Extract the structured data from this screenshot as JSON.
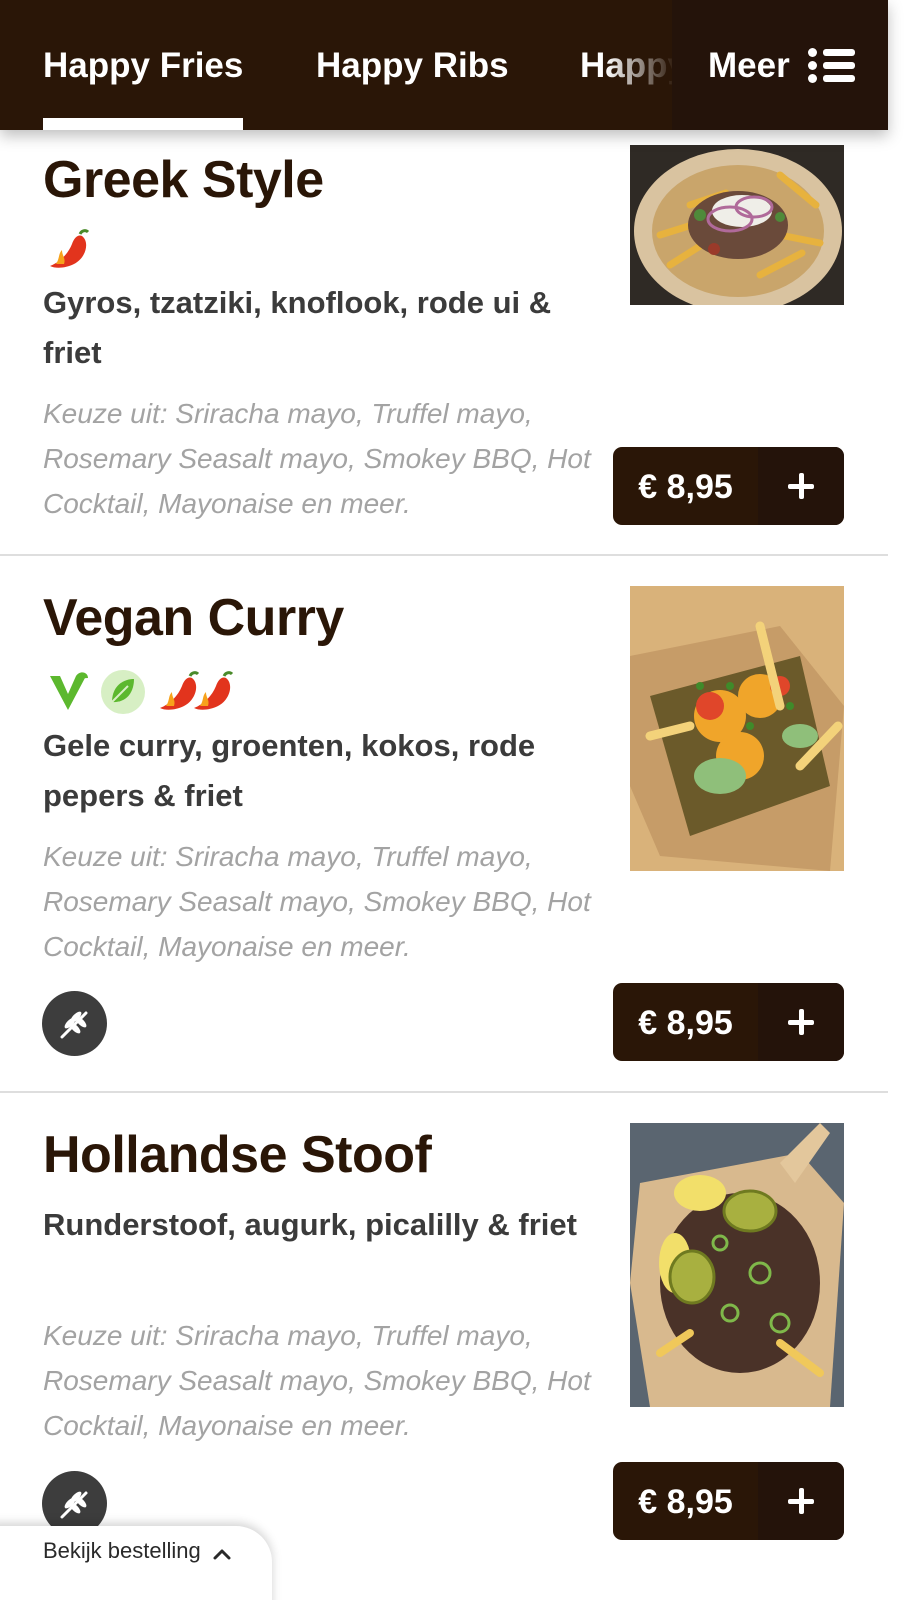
{
  "nav": {
    "tabs": [
      {
        "label": "Happy Fries",
        "active": true
      },
      {
        "label": "Happy Ribs",
        "active": false
      },
      {
        "label": "Happy",
        "active": false
      }
    ],
    "more_label": "Meer",
    "more_icon": "list-icon"
  },
  "products": [
    {
      "title": "Greek Style",
      "badges": [
        "chili-pepper-icon"
      ],
      "description": "Gyros, tzatziki, knoflook, rode ui & friet",
      "choices": "Keuze uit: Sriracha mayo, Truffel mayo, Rosemary Seasalt mayo, Smokey BBQ, Hot Cocktail, Mayonaise en meer.",
      "price": "€ 8,95",
      "add_icon": "plus-icon",
      "allergen_icon": null
    },
    {
      "title": "Vegan Curry",
      "badges": [
        "vegan-icon",
        "vegetarian-leaf-icon",
        "chili-pepper-icon",
        "chili-pepper-icon"
      ],
      "description": "Gele curry, groenten, kokos, rode pepers & friet",
      "choices": "Keuze uit: Sriracha mayo, Truffel mayo, Rosemary Seasalt mayo, Smokey BBQ, Hot Cocktail, Mayonaise en meer.",
      "price": "€ 8,95",
      "add_icon": "plus-icon",
      "allergen_icon": "gluten-wheat-icon"
    },
    {
      "title": "Hollandse Stoof",
      "badges": [],
      "description": "Runderstoof, augurk, picalilly & friet",
      "choices": "Keuze uit: Sriracha mayo, Truffel mayo, Rosemary Seasalt mayo, Smokey BBQ, Hot Cocktail, Mayonaise en meer.",
      "price": "€ 8,95",
      "add_icon": "plus-icon",
      "allergen_icon": "gluten-wheat-icon"
    }
  ],
  "order_bar": {
    "label": "Bekijk bestelling",
    "icon": "chevron-up-icon"
  },
  "colors": {
    "header": "#2a1607",
    "button": "#2a1607",
    "title": "#2a1607",
    "choice_text": "#a3a3a3",
    "vegan_green": "#5cb82e"
  }
}
